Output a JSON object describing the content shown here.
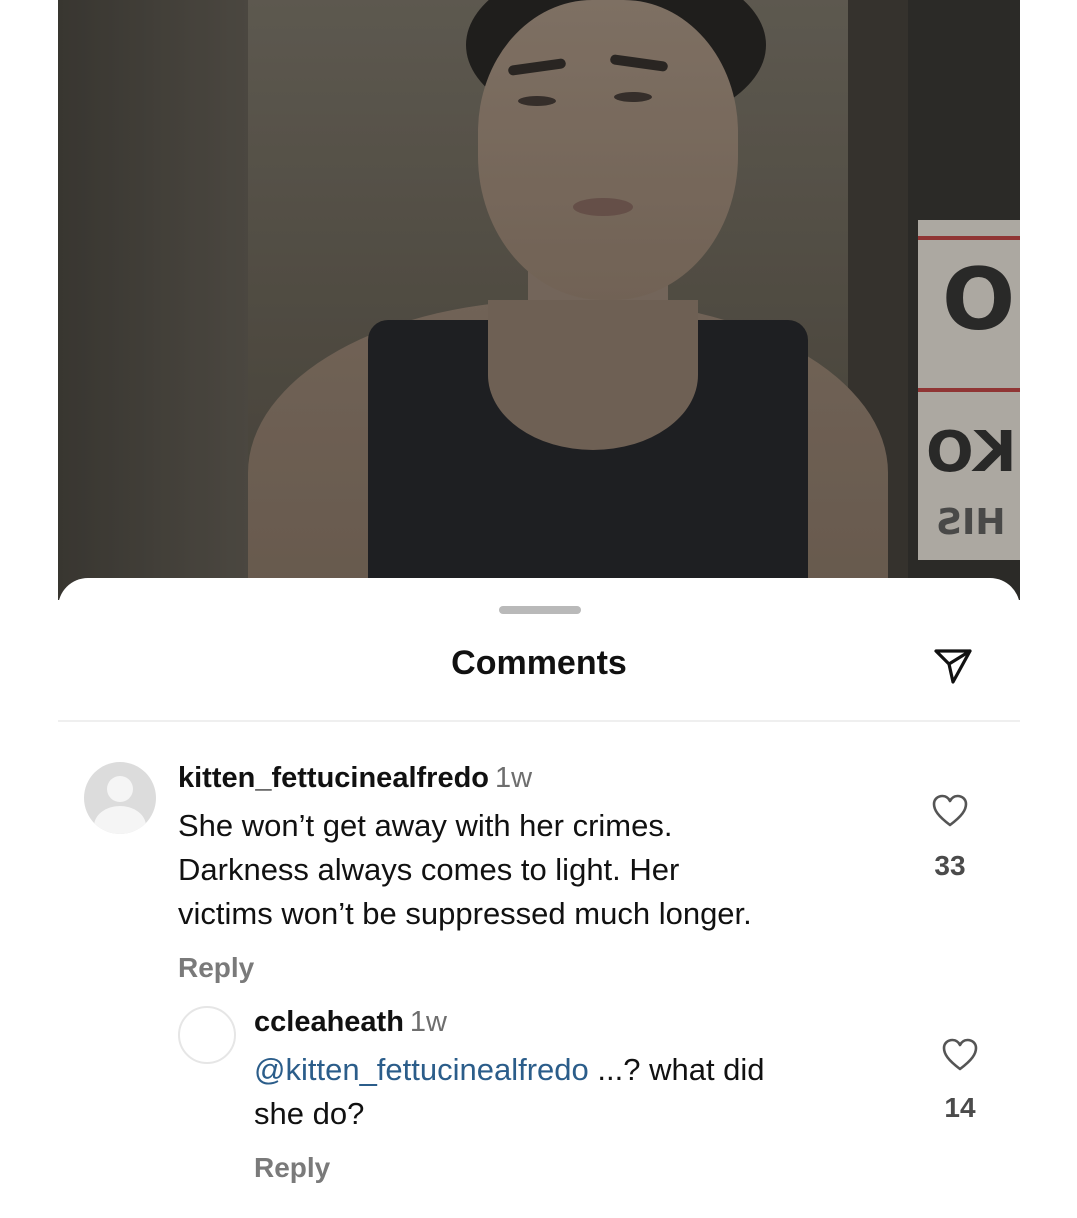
{
  "photo": {
    "sign_large": "O",
    "sign_mid": "KO",
    "sign_small": "HIS"
  },
  "sheet": {
    "title": "Comments",
    "send_icon": "send-icon"
  },
  "comments": [
    {
      "username": "kitten_fettucinealfredo",
      "time": "1w",
      "lines": [
        "She won’t get away with her crimes.",
        "Darkness always comes to light. Her",
        "victims won’t be suppressed much longer."
      ],
      "reply_label": "Reply",
      "likes": "33",
      "icon": "heart-icon"
    },
    {
      "username": "ccleaheath",
      "time": "1w",
      "mention": "@kitten_fettucinealfredo",
      "text_after_mention": " ...? what did",
      "line2": "she do?",
      "reply_label": "Reply",
      "likes": "14",
      "icon": "heart-icon"
    }
  ]
}
